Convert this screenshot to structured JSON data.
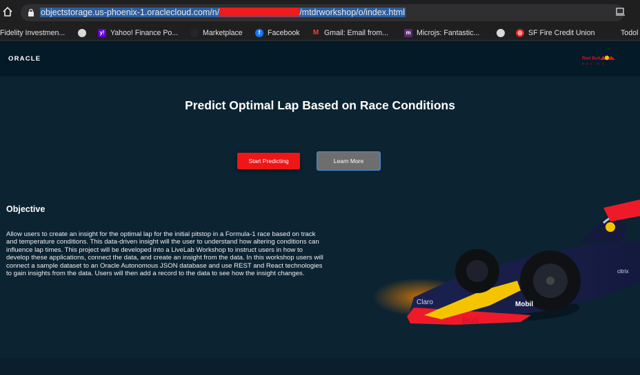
{
  "browser": {
    "url_before": "objectstorage.us-phoenix-1.oraclecloud.com/n/",
    "url_after": "/mtdrworkshop/o/index.html",
    "bookmarks": [
      {
        "label": "Fidelity Investmen...",
        "icon": "none"
      },
      {
        "label": "",
        "icon": "globe-icon"
      },
      {
        "label": "Yahoo! Finance Po...",
        "icon": "yahoo-icon"
      },
      {
        "label": "Marketplace",
        "icon": "github-icon"
      },
      {
        "label": "Facebook",
        "icon": "facebook-icon"
      },
      {
        "label": "Gmail: Email from...",
        "icon": "gmail-icon"
      },
      {
        "label": "Microjs: Fantastic...",
        "icon": "microjs-icon"
      },
      {
        "label": "",
        "icon": "globe-icon"
      },
      {
        "label": "SF Fire Credit Union",
        "icon": "target-icon"
      },
      {
        "label": "Todol",
        "icon": "none"
      }
    ]
  },
  "header": {
    "logo": "ORACLE",
    "partner_logo": "Red Bull RACING"
  },
  "hero": {
    "title": "Predict Optimal Lap Based on Race Conditions",
    "start_button": "Start Predicting",
    "learn_button": "Learn More"
  },
  "objective": {
    "title": "Objective",
    "body": "Allow users to create an insight for the optimal lap for the initial pitstop in a Formula-1 race based on track and temperature conditions. This data-driven insight will the user to understand how altering conditions can influence lap times. This project will be developed into a LiveLab Workshop to instruct users in how to develop these applications, connect the data, and create an insight from the data. In this workshop users will connect a sample dataset to an Oracle Autonomous JSON database and use REST and React technologies to gain insights from the data. Users will then add a record to the data to see how the insight changes."
  },
  "colors": {
    "accent_red": "#ee1616",
    "header_bg": "#051a27",
    "page_bg": "#0c2332"
  }
}
